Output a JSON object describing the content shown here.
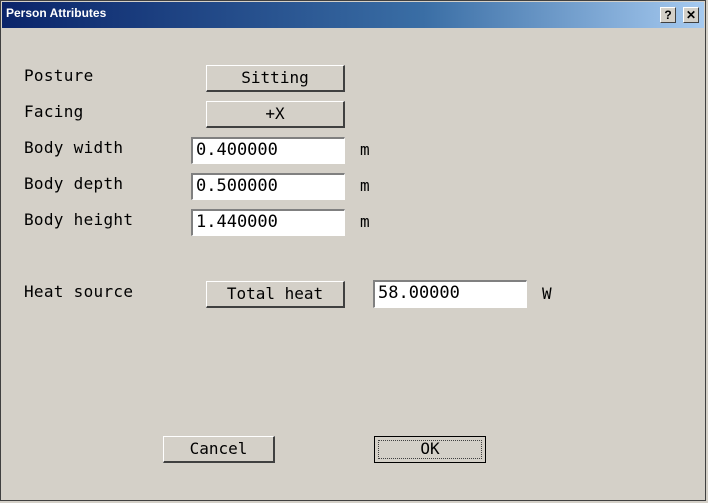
{
  "window": {
    "title": "Person Attributes",
    "help_glyph": "?",
    "close_glyph": "✕"
  },
  "form": {
    "posture": {
      "label": "Posture",
      "value": "Sitting"
    },
    "facing": {
      "label": "Facing",
      "value": "+X"
    },
    "body_width": {
      "label": "Body width",
      "value": "0.400000",
      "unit": "m"
    },
    "body_depth": {
      "label": "Body depth",
      "value": "0.500000",
      "unit": "m"
    },
    "body_height": {
      "label": "Body height",
      "value": "1.440000",
      "unit": "m"
    },
    "heat_source": {
      "label": "Heat source",
      "mode": "Total heat",
      "value": "58.00000",
      "unit": "W"
    }
  },
  "buttons": {
    "cancel": "Cancel",
    "ok": "OK"
  }
}
